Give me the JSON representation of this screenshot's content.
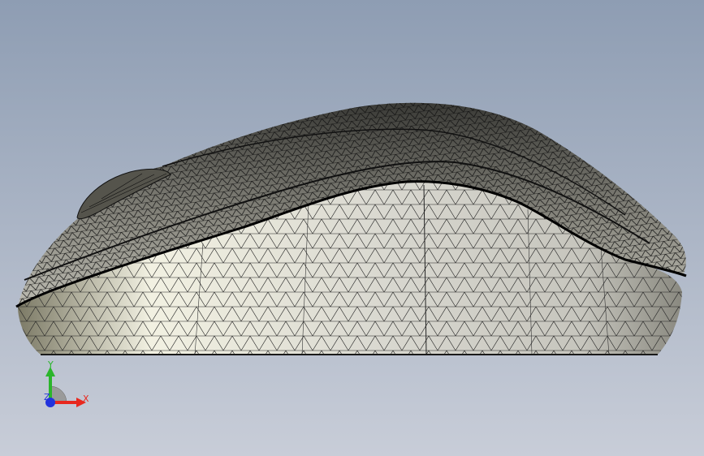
{
  "viewport": {
    "background_top": "#8e9db3",
    "background_bottom": "#c8cdd8"
  },
  "model": {
    "name": "computer-mouse-mesh",
    "render_mode": "shaded-with-edges",
    "shell_color": "#e8e6dc",
    "edge_color": "#111111"
  },
  "triad": {
    "x_label": "X",
    "y_label": "Y",
    "z_label": "Z",
    "x_color": "#e8281e",
    "y_color": "#2bb52b",
    "z_color": "#2233dd"
  }
}
